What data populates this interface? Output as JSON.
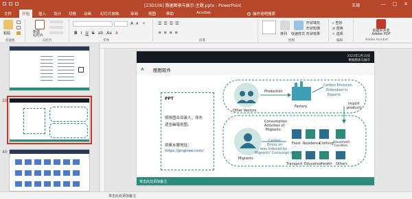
{
  "window": {
    "title": "[Z3D106] 数据图表与展示-主题.pptx - PowerPoint",
    "user": "王琦",
    "controls": [
      "—",
      "□",
      "✕"
    ]
  },
  "tabs": {
    "items": [
      "文件",
      "开始",
      "插入",
      "设计",
      "切换",
      "动画",
      "幻灯片放映",
      "审阅",
      "视图",
      "帮助",
      "Acrobat"
    ],
    "active_index": 1,
    "search_label": "操作说明搜索"
  },
  "ribbon": {
    "paste_label": "粘贴",
    "new_slide_label": "新建\n幻灯片",
    "clipboard_group": "剪贴板",
    "slides_group": "幻灯片",
    "font_group": "字体",
    "paragraph_group": "段落",
    "drawing_group": "绘图",
    "editing_group": "编辑",
    "acrobat_group": "Adobe Acrobat",
    "arrange_label": "排列",
    "quick_styles_label": "快速样式",
    "find_label": "查找",
    "replace_label": "替换",
    "select_label": "选择",
    "create_pdf_label": "创建并共享\nAdobe PDF",
    "font_name": "",
    "font_size": "",
    "shape_fill": "形状填充",
    "shape_outline": "形状轮廓",
    "shape_effects": "形状效果"
  },
  "thumbnails": {
    "numbers": [
      "",
      "39",
      "40"
    ],
    "selected_index": 1
  },
  "slide": {
    "date_line1": "2023年1月15日",
    "date_line2": "数据图表与展示",
    "logo": "ʌ",
    "title": "图图软件",
    "left_box": {
      "heading": "PPT",
      "line1": "将拼图合目录人，非东",
      "line2": "适全幽暗觉图。",
      "line3": "拼素乡搬地址：",
      "link": "https://pngtree.com/"
    },
    "diagram": {
      "other_vectors": "Other Vectors",
      "production": "Production",
      "factory": "Factory",
      "carbon_emission": "Carbon Emission\nEmbodied in\nExports",
      "import_products": "Import\nproducts",
      "migrants": "Migrants",
      "consumption": "Consumption\nActivities of\nMigrants",
      "carbon_emission_2": "Carbon\nEmiss on\nwas Induced by\nMigrants' Consumpt on",
      "food": "Food",
      "residence": "Residence",
      "clothing": "Clothing",
      "household": "Household\nFacilities",
      "transport": "Transport",
      "education": "Education",
      "health": "Health",
      "others": "Others"
    },
    "bottom_text": "单击此处添加备注"
  },
  "notes": {
    "placeholder": "单击此处添加备注"
  },
  "colors": {
    "accent": "#b7472a",
    "teal": "#2b8c7d",
    "dark": "#13191f"
  }
}
